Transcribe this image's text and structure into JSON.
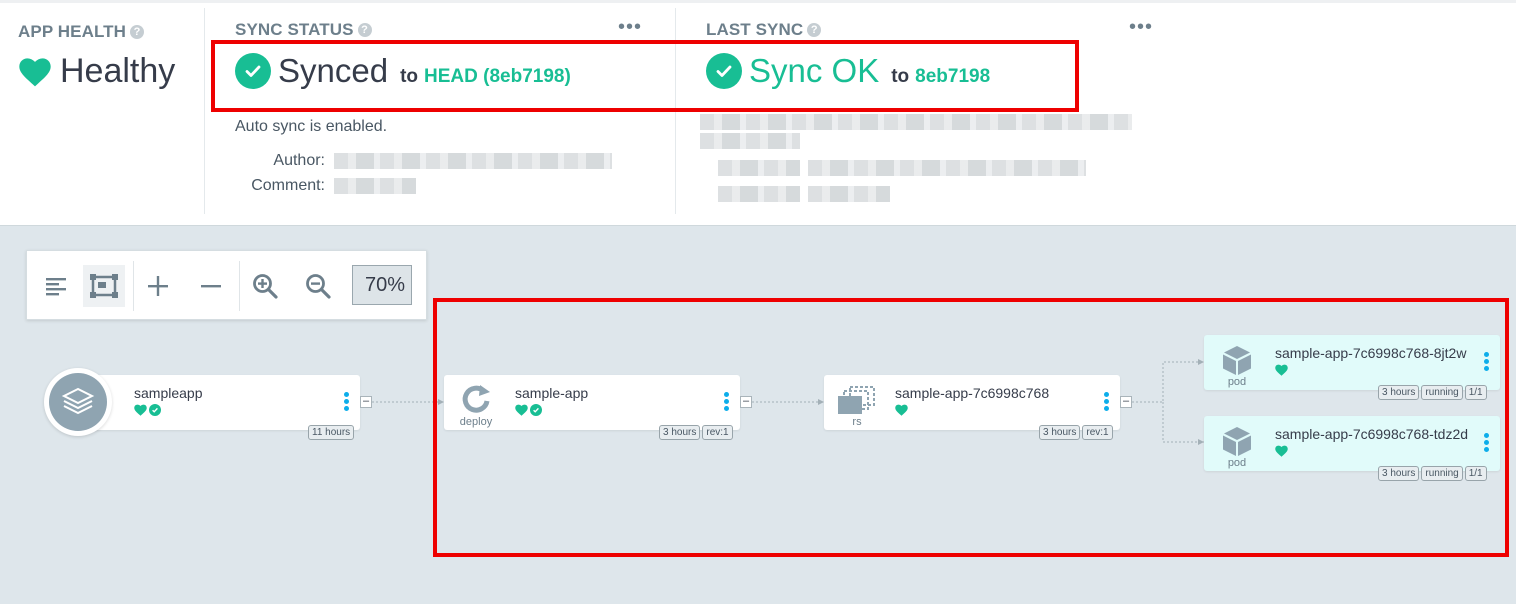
{
  "app_health": {
    "header": "APP HEALTH",
    "value": "Healthy",
    "color": "#18be94"
  },
  "sync_status": {
    "header": "SYNC STATUS",
    "status": "Synced",
    "to_label": "to",
    "revision": "HEAD (8eb7198)",
    "auto_sync": "Auto sync is enabled.",
    "author_label": "Author:",
    "comment_label": "Comment:"
  },
  "last_sync": {
    "header": "LAST SYNC",
    "status": "Sync OK",
    "to_label": "to",
    "revision": "8eb7198"
  },
  "help_glyph": "?",
  "menu_glyph": "•••",
  "toolbar": {
    "zoom": "70%",
    "icons": [
      "list-view-icon",
      "fit-screen-icon",
      "expand-icon",
      "collapse-icon",
      "zoom-in-icon",
      "zoom-out-icon"
    ]
  },
  "graph": {
    "nodes": [
      {
        "id": "app",
        "title": "sampleapp",
        "kind": "",
        "tags": [
          "11 hours"
        ]
      },
      {
        "id": "deploy",
        "title": "sample-app",
        "kind": "deploy",
        "tags": [
          "3 hours",
          "rev:1"
        ]
      },
      {
        "id": "rs",
        "title": "sample-app-7c6998c768",
        "kind": "rs",
        "tags": [
          "3 hours",
          "rev:1"
        ]
      },
      {
        "id": "pod1",
        "title": "sample-app-7c6998c768-8jt2w",
        "kind": "pod",
        "tags": [
          "3 hours",
          "running",
          "1/1"
        ]
      },
      {
        "id": "pod2",
        "title": "sample-app-7c6998c768-tdz2d",
        "kind": "pod",
        "tags": [
          "3 hours",
          "running",
          "1/1"
        ]
      }
    ],
    "collapse_glyph": "–"
  },
  "colors": {
    "healthy": "#18be94",
    "highlight": "#ee0000",
    "accent_blue": "#0dadea"
  }
}
